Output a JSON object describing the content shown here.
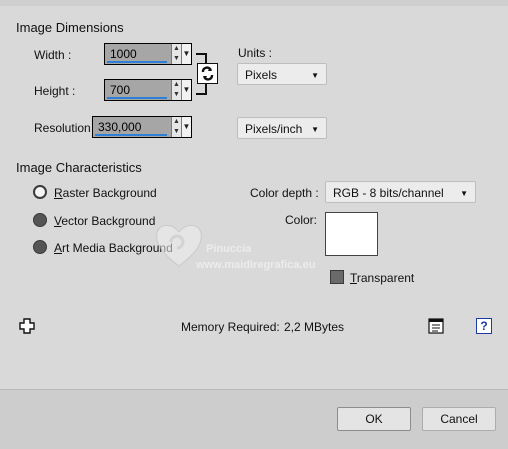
{
  "image_dimensions": {
    "title": "Image Dimensions",
    "width_label": "Width :",
    "width_value": "1000",
    "height_label": "Height :",
    "height_value": "700",
    "resolution_label": "Resolution :",
    "resolution_value": "330,000",
    "units_label": "Units :",
    "units_value": "Pixels",
    "resolution_units_value": "Pixels/inch"
  },
  "image_characteristics": {
    "title": "Image Characteristics",
    "radio_options": [
      {
        "first": "R",
        "rest": "aster Background",
        "checked": true
      },
      {
        "first": "V",
        "rest": "ector Background",
        "checked": false
      },
      {
        "first": "A",
        "rest": "rt Media Background",
        "checked": false
      }
    ],
    "color_depth_label": "Color depth :",
    "color_depth_value": "RGB - 8 bits/channel",
    "color_label": "Color:",
    "color_value": "#ffffff",
    "transparent_first": "T",
    "transparent_rest": "ransparent"
  },
  "memory": {
    "label": "Memory Required:",
    "value": "2,2 MBytes"
  },
  "watermark": {
    "line1": "Pinuccia",
    "line2": "www.maidiregrafica.eu"
  },
  "buttons": {
    "ok": "OK",
    "cancel": "Cancel"
  },
  "icons": {
    "link": "link-chain-icon",
    "presets": "crosshair-plus-icon",
    "notes": "notes-icon",
    "help": "help-icon"
  }
}
